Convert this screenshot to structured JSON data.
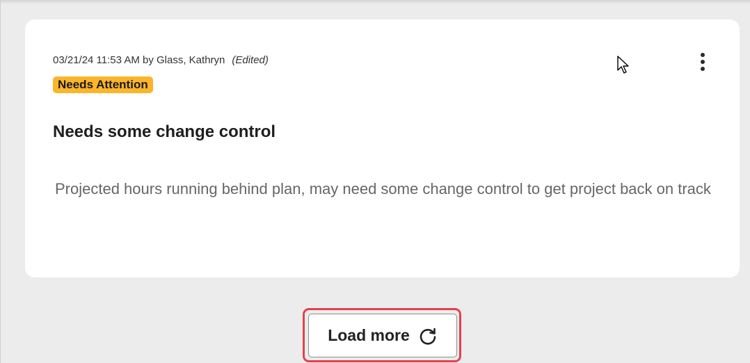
{
  "note": {
    "meta": "03/21/24 11:53 AM by Glass, Kathryn",
    "edited_tag": "(Edited)",
    "status_badge": "Needs Attention",
    "title": "Needs some change control",
    "body": "Projected hours running behind plan, may need some change control to get project back on track"
  },
  "actions": {
    "load_more_label": "Load more"
  },
  "icons": {
    "menu": "more-vertical-icon",
    "refresh": "refresh-icon",
    "cursor": "mouse-pointer-icon"
  },
  "colors": {
    "badge": "#fbb52b",
    "highlight": "#e0424d",
    "background": "#ececec"
  }
}
